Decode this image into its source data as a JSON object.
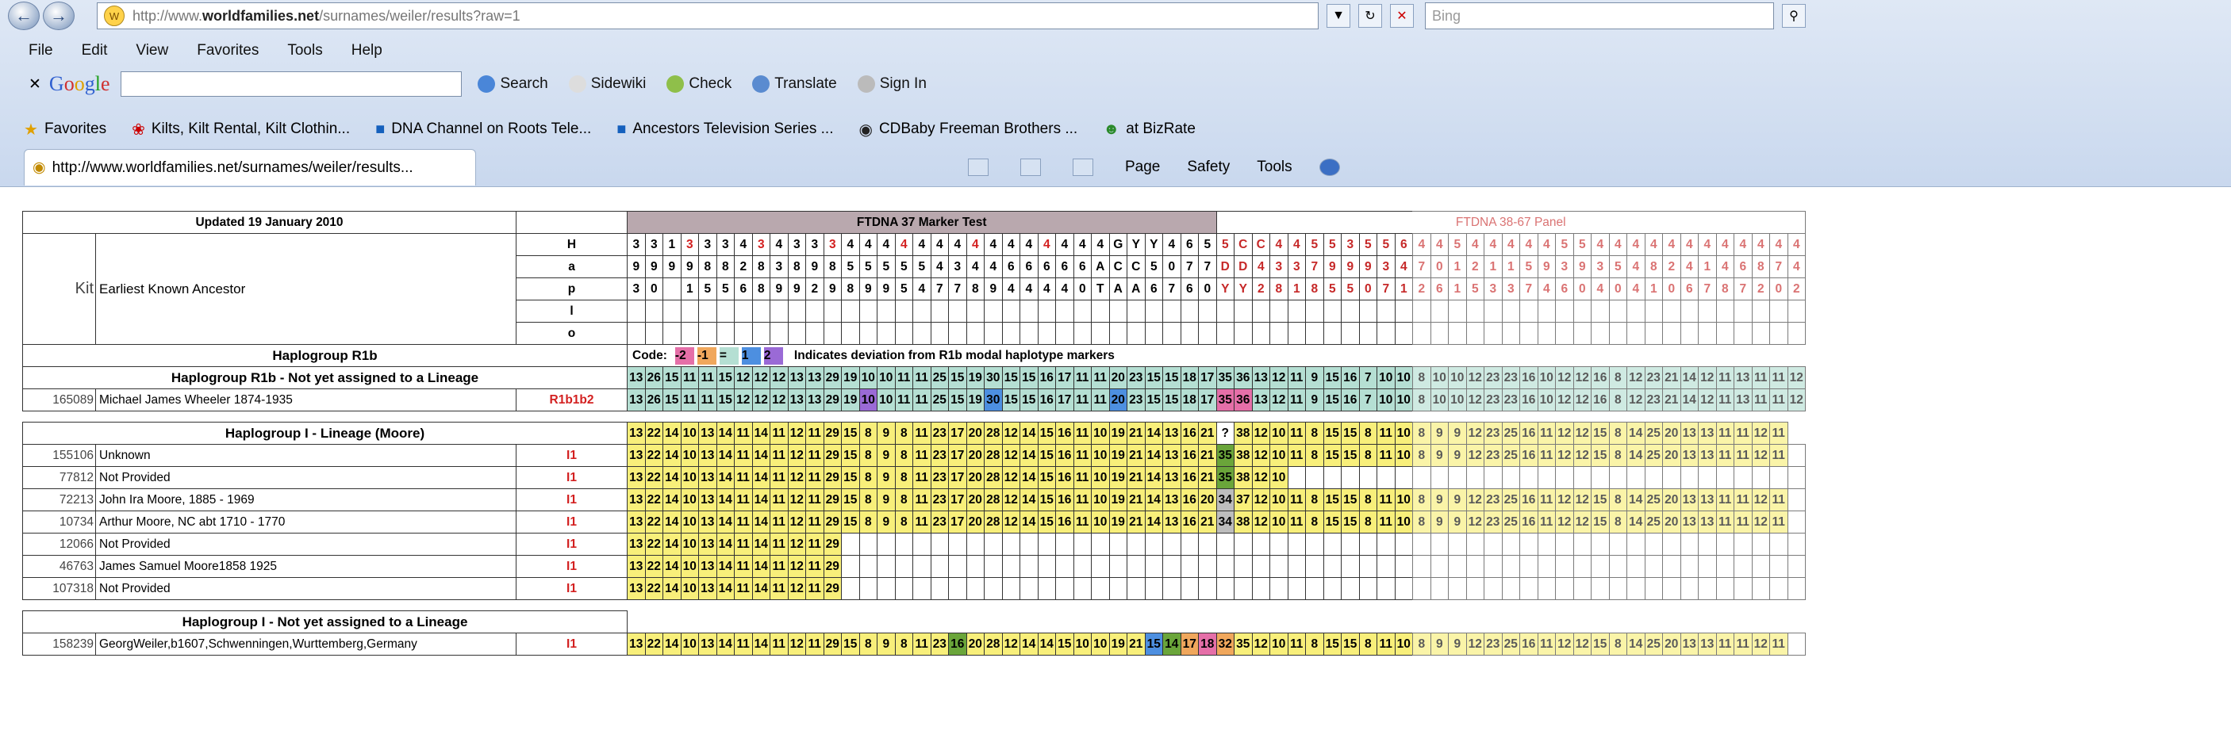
{
  "browser": {
    "url_prefix": "http://www.",
    "url_domain": "worldfamilies.net",
    "url_path": "/surnames/weiler/results?raw=1",
    "search_placeholder": "Bing",
    "menu": [
      "File",
      "Edit",
      "View",
      "Favorites",
      "Tools",
      "Help"
    ],
    "google_toolbar": [
      "Search",
      "Sidewiki",
      "Check",
      "Translate",
      "Sign In"
    ],
    "favorites_label": "Favorites",
    "favorites": [
      "Kilts, Kilt Rental, Kilt Clothin...",
      "DNA Channel on Roots Tele...",
      "Ancestors Television Series ...",
      "CDBaby  Freeman Brothers ...",
      "at BizRate"
    ],
    "tab_title": "http://www.worldfamilies.net/surnames/weiler/results...",
    "cmd_bar": [
      "Page",
      "Safety",
      "Tools"
    ]
  },
  "table": {
    "updated": "Updated 19 January 2010",
    "kit_header": "Kit",
    "ancestor_header": "Earliest Known Ancestor",
    "ftdna_header": "FTDNA  37 Marker Test",
    "panel_header": "FTDNA 38-67 Panel",
    "row_labels": [
      "H",
      "a",
      "p",
      "l",
      "o"
    ],
    "header_H": [
      "3",
      "3",
      "1",
      "3",
      "3",
      "3",
      "4",
      "3",
      "4",
      "3",
      "3",
      "3",
      "4",
      "4",
      "4",
      "4",
      "4",
      "4",
      "4",
      "4",
      "4",
      "4",
      "4",
      "4",
      "4",
      "4",
      "4",
      "G",
      "Y",
      "Y",
      "4",
      "6",
      "5",
      "5",
      "C",
      "C",
      "4",
      "4",
      "5",
      "5",
      "3",
      "5",
      "5",
      "6",
      "4",
      "4",
      "5",
      "4",
      "4",
      "4",
      "4",
      "4",
      "5",
      "5",
      "4",
      "4",
      "4",
      "4",
      "4",
      "4",
      "4",
      "4",
      "4",
      "4",
      "4",
      "4",
      "4",
      "4",
      "4",
      "4",
      "5"
    ],
    "header_a": [
      "9",
      "9",
      "9",
      "9",
      "8",
      "8",
      "2",
      "8",
      "3",
      "8",
      "9",
      "8",
      "5",
      "5",
      "5",
      "5",
      "5",
      "4",
      "3",
      "4",
      "4",
      "6",
      "6",
      "6",
      "6",
      "6",
      "A",
      "C",
      "C",
      "5",
      "0",
      "7",
      "7",
      "D",
      "D",
      "4",
      "3",
      "3",
      "7",
      "9",
      "9",
      "9",
      "3",
      "4",
      "7",
      "0",
      "1",
      "2",
      "1",
      "1",
      "5",
      "9",
      "3",
      "9",
      "3",
      "5",
      "4",
      "8",
      "2",
      "4",
      "1",
      "4",
      "6",
      "8",
      "7",
      "4",
      "9",
      "6",
      "6",
      "6",
      "6"
    ],
    "header_p": [
      "3",
      "0",
      "",
      "1",
      "5",
      "5",
      "6",
      "8",
      "9",
      "9",
      "2",
      "9",
      "8",
      "9",
      "9",
      "5",
      "4",
      "7",
      "7",
      "8",
      "9",
      "4",
      "4",
      "4",
      "4",
      "0",
      "T",
      "A",
      "A",
      "6",
      "7",
      "6",
      "0",
      "Y",
      "Y",
      "2",
      "8",
      "1",
      "8",
      "5",
      "5",
      "0",
      "7",
      "1",
      "2",
      "6",
      "1",
      "5",
      "3",
      "3",
      "7",
      "4",
      "6",
      "0",
      "4",
      "0",
      "4",
      "1",
      "0",
      "6",
      "7",
      "8",
      "7",
      "2",
      "0",
      "2",
      "5",
      "5",
      "5",
      "5",
      "5"
    ],
    "code_label": "Code:",
    "code_values": [
      "-2",
      "-1",
      "=",
      "1",
      "2"
    ],
    "code_text": "Indicates deviation from R1b modal haplotype markers",
    "sections": [
      {
        "title": "Haplogroup R1b",
        "subtitle": "Haplogroup R1b - Not yet assigned to a Lineage",
        "rows": [
          {
            "kit": "165089",
            "ancestor": "Michael James Wheeler 1874-1935",
            "haplo": "R1b1b2",
            "values": "13 26 15 11 11 15 12 12 12 13 13 29 19 10 10 11 11 25 15 19 30 15 15 16 17 11 11 20 23 15 15 18 17 35 36 13 12 11 9 15 16 7 10 10 8 10 10 12 23 23 16 10 12 12 16 8 12 23 21 14 12 11 13 11 11 12 12"
          }
        ]
      },
      {
        "title": "Haplogroup I - Lineage (Moore)",
        "modal": "13 22 14 10 13 14 11 14 11 12 11 29 15 8 9 8 11 23 17 20 28 12 14 15 16 11 10 19 21 14 13 16 21 ? 38 12 10 11 8 15 15 8 11 10 8 9 9 12 23 25 16 11 12 12 15 8 14 25 20 13 13 11 11 12 11",
        "rows": [
          {
            "kit": "155106",
            "ancestor": "Unknown",
            "haplo": "I1",
            "values": "13 22 14 10 13 14 11 14 11 12 11 29 15 8 9 8 11 23 17 20 28 12 14 15 16 11 10 19 21 14 13 16 21 35 38 12 10 11 8 15 15 8 11 10 8 9 9 12 23 25 16 11 12 12 15 8 14 25 20 13 13 11 11 12 11"
          },
          {
            "kit": "77812",
            "ancestor": "Not Provided",
            "haplo": "I1",
            "values": "13 22 14 10 13 14 11 14 11 12 11 29 15 8 9 8 11 23 17 20 28 12 14 15 16 11 10 19 21 14 13 16 21 35 38 12 10"
          },
          {
            "kit": "72213",
            "ancestor": "John Ira Moore, 1885 - 1969",
            "haplo": "I1",
            "values": "13 22 14 10 13 14 11 14 11 12 11 29 15 8 9 8 11 23 17 20 28 12 14 15 16 11 10 19 21 14 13 16 20 34 37 12 10 11 8 15 15 8 11 10 8 9 9 12 23 25 16 11 12 12 15 8 14 25 20 13 13 11 11 12 11"
          },
          {
            "kit": "10734",
            "ancestor": "Arthur Moore, NC abt 1710 - 1770",
            "haplo": "I1",
            "values": "13 22 14 10 13 14 11 14 11 12 11 29 15 8 9 8 11 23 17 20 28 12 14 15 16 11 10 19 21 14 13 16 21 34 38 12 10 11 8 15 15 8 11 10 8 9 9 12 23 25 16 11 12 12 15 8 14 25 20 13 13 11 11 12 11"
          },
          {
            "kit": "12066",
            "ancestor": "Not Provided",
            "haplo": "I1",
            "values": "13 22 14 10 13 14 11 14 11 12 11 29"
          },
          {
            "kit": "46763",
            "ancestor": "James Samuel Moore1858 1925",
            "haplo": "I1",
            "values": "13 22 14 10 13 14 11 14 11 12 11 29"
          },
          {
            "kit": "107318",
            "ancestor": "Not Provided",
            "haplo": "I1",
            "values": "13 22 14 10 13 14 11 14 11 12 11 29"
          }
        ]
      },
      {
        "title": "Haplogroup I - Not yet assigned to a Lineage",
        "rows": [
          {
            "kit": "158239",
            "ancestor": "GeorgWeiler,b1607,Schwenningen,Wurttemberg,Germany",
            "haplo": "I1",
            "values": "13 22 14 10 13 14 11 14 11 12 11 29 15 8 9 8 11 23 16 20 28 12 14 14 15 10 10 19 21 15 14 17 18 32 35 12 10 11 8 15 15 8 11 10 8 9 9 12 23 25 16 11 12 12 15 8 14 25 20 13 13 11 11 12 11"
          }
        ]
      }
    ],
    "colors": {
      "yellow": "#f8ef7a",
      "teal": "#b5dfd3",
      "blue": "#4d8fe0",
      "purple": "#9a6ad6",
      "green": "#6aa53a",
      "orange": "#f0a75c",
      "pink": "#e56fa8",
      "red_text": "#d32020",
      "green_text": "#1a7a1a"
    }
  }
}
